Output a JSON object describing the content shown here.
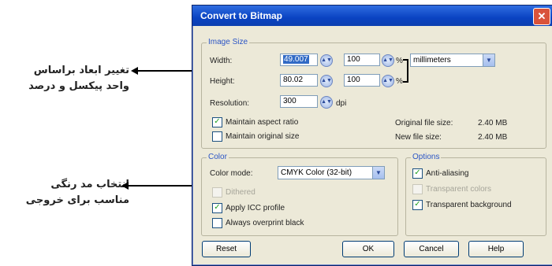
{
  "annotations": {
    "resize_line1": "تغییر ابعاد براساس",
    "resize_line2": "واحد پیکسل و درصد",
    "color_line1": "انتخاب مد رنگی",
    "color_line2": "مناسب برای خروجی"
  },
  "window": {
    "title": "Convert to Bitmap",
    "close_glyph": "✕"
  },
  "image_size": {
    "legend": "Image Size",
    "width_label": "Width:",
    "width_value": "49.007",
    "width_percent": "100",
    "height_label": "Height:",
    "height_value": "80.02",
    "height_percent": "100",
    "percent_unit": "%",
    "units_value": "millimeters",
    "resolution_label": "Resolution:",
    "resolution_value": "300",
    "resolution_unit": "dpi",
    "maintain_aspect": "Maintain aspect ratio",
    "maintain_original": "Maintain original size",
    "original_size_label": "Original file size:",
    "original_size_value": "2.40 MB",
    "new_size_label": "New file size:",
    "new_size_value": "2.40 MB"
  },
  "color": {
    "legend": "Color",
    "mode_label": "Color mode:",
    "mode_value": "CMYK Color (32-bit)",
    "dithered": "Dithered",
    "apply_icc": "Apply ICC profile",
    "overprint": "Always overprint black"
  },
  "options": {
    "legend": "Options",
    "anti_aliasing": "Anti-aliasing",
    "transparent_bg_disabled": "Transparent colors",
    "transparent_bg": "Transparent background"
  },
  "buttons": {
    "reset": "Reset",
    "ok": "OK",
    "cancel": "Cancel",
    "help": "Help"
  },
  "check_glyph": "✓"
}
